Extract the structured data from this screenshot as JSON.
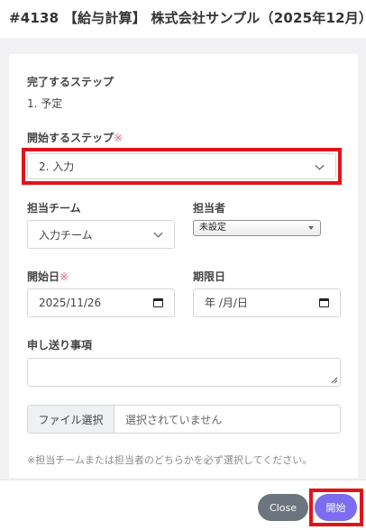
{
  "header": {
    "title": "#4138 【給与計算】 株式会社サンプル（2025年12月）"
  },
  "form": {
    "complete_step": {
      "label": "完了するステップ",
      "value": "1. 予定"
    },
    "start_step": {
      "label": "開始するステップ",
      "required_mark": "※",
      "selected": "2. 入力"
    },
    "team": {
      "label": "担当チーム",
      "selected": "入力チーム"
    },
    "assignee": {
      "label": "担当者",
      "selected": "未設定"
    },
    "start_date": {
      "label": "開始日",
      "required_mark": "※",
      "value": "2025/11/26"
    },
    "due_date": {
      "label": "期限日",
      "placeholder": "年 /月/日"
    },
    "handover": {
      "label": "申し送り事項"
    },
    "file": {
      "button_label": "ファイル選択",
      "status": "選択されていません"
    },
    "note": "※担当チームまたは担当者のどちらかを必ず選択してください。"
  },
  "footer": {
    "close_label": "Close",
    "start_label": "開始"
  },
  "colors": {
    "highlight": "#e0141b",
    "primary": "#7b6cf0",
    "secondary": "#6c757d",
    "required": "#e06b8b"
  }
}
